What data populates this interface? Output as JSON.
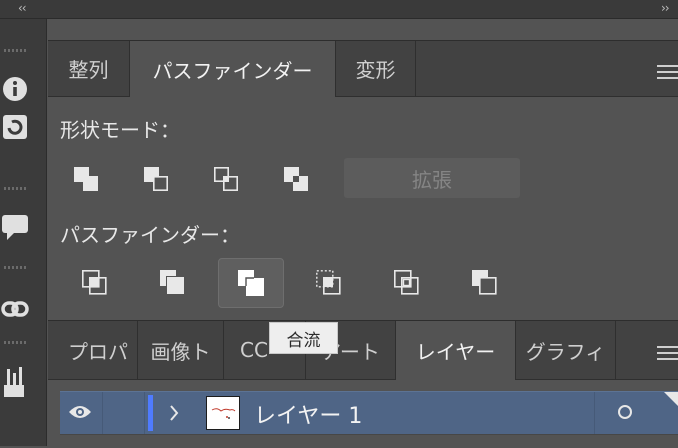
{
  "window": {
    "left_chevron": "‹‹",
    "right_chevron": "››"
  },
  "pathfinder_panel": {
    "tabs": [
      {
        "label": "整列",
        "active": false
      },
      {
        "label": "パスファインダー",
        "active": true
      },
      {
        "label": "変形",
        "active": false
      }
    ],
    "shape_modes": {
      "label": "形状モード：",
      "buttons": [
        "unite",
        "minus-front",
        "intersect",
        "exclude"
      ],
      "expand_label": "拡張"
    },
    "pathfinders": {
      "label": "パスファインダー：",
      "buttons": [
        "divide",
        "trim",
        "merge",
        "crop",
        "outline",
        "minus-back"
      ],
      "hovered": "merge"
    },
    "tooltip": "合流"
  },
  "layers_panel": {
    "tabs": [
      {
        "label": "プロパ",
        "active": false
      },
      {
        "label": "画像ト",
        "active": false
      },
      {
        "label": "CC",
        "active": false
      },
      {
        "label": "アート",
        "active": false
      },
      {
        "label": "レイヤー",
        "active": true
      },
      {
        "label": "グラフィ",
        "active": false
      }
    ],
    "layer": {
      "name": "レイヤー 1",
      "visible": true,
      "color": "#4f7bff",
      "selected": true
    }
  },
  "toolbar_icons": [
    "info-icon",
    "refresh-icon",
    "comment-icon",
    "link-icon",
    "brushes-icon"
  ]
}
